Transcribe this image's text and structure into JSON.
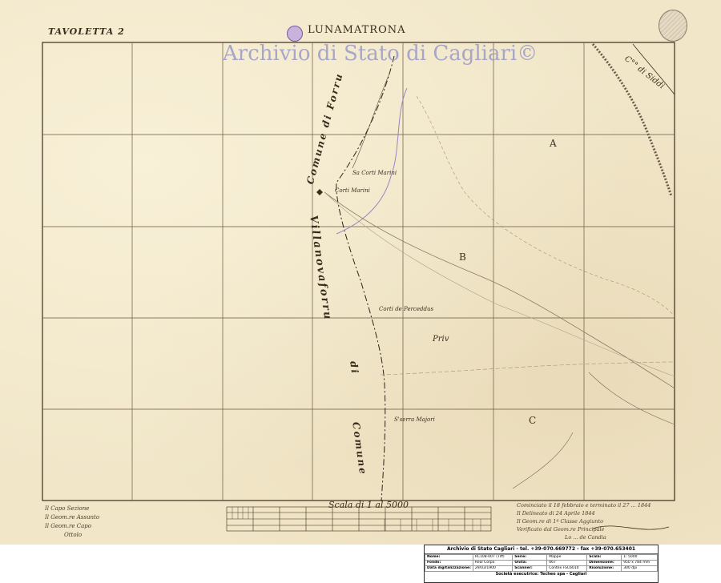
{
  "map": {
    "sheet_label": "TAVOLETTA 2",
    "title": "LUNAMATRONA",
    "watermark": "Archivio di Stato di Cagliari©",
    "scale_title": "Scala di 1 al 5000",
    "top_right_label": "C°° di Siddi",
    "commune_forru": "Comune di Forru",
    "commune_villanovaforru": "Villanovaforru",
    "commune_of": "di",
    "commune_word": "Comune",
    "places": [
      {
        "id": "sa-corti-marini",
        "text": "Sa Corti Marini"
      },
      {
        "id": "corti-marini",
        "text": "Corti Marini"
      },
      {
        "id": "corti-de-perceddus",
        "text": "Corti de Perceddus"
      },
      {
        "id": "s-serra-majori",
        "text": "S'serra Majori"
      },
      {
        "id": "priv",
        "text": "Priv"
      }
    ],
    "regions": [
      {
        "id": "A",
        "text": "A"
      },
      {
        "id": "B",
        "text": "B"
      },
      {
        "id": "C",
        "text": "C"
      }
    ],
    "signatures_left": [
      "Il Capo Sezione",
      "Il Geom.re Assunto",
      "Il Geom.re Capo",
      "Ottolo"
    ],
    "signatures_right": [
      "Cominciato il 18 febbraio e terminato il 27 ... 1844",
      "Il Delineato di 24 Aprile 1844",
      "Il Geom.re di 1ª Classe Aggiunto",
      "Verificato dal Geom.re Principale",
      "Lo ... de Candia"
    ]
  },
  "archive": {
    "header": "Archivio di Stato Cagliari - tel. +39-070.669772 - fax +39-070.653401",
    "rows": [
      [
        {
          "k": "Nome:",
          "v": "RC108-007 (Tiff)"
        },
        {
          "k": "Serie:",
          "v": "Mappe"
        },
        {
          "k": "Scala:",
          "v": "1: 5000"
        }
      ],
      [
        {
          "k": "Fondo:",
          "v": "Real Corpo"
        },
        {
          "k": "Unità:",
          "v": "067"
        },
        {
          "k": "Dimensione:",
          "v": "950 x 784 mm"
        }
      ],
      [
        {
          "k": "Data digitalizzazione:",
          "v": "29/03/1900"
        },
        {
          "k": "Scanner:",
          "v": "Contex FSC6010"
        },
        {
          "k": "Risoluzione:",
          "v": "300 dpi"
        }
      ]
    ],
    "footer": "Società esecutrice: Techeo spa - Cagliari"
  }
}
